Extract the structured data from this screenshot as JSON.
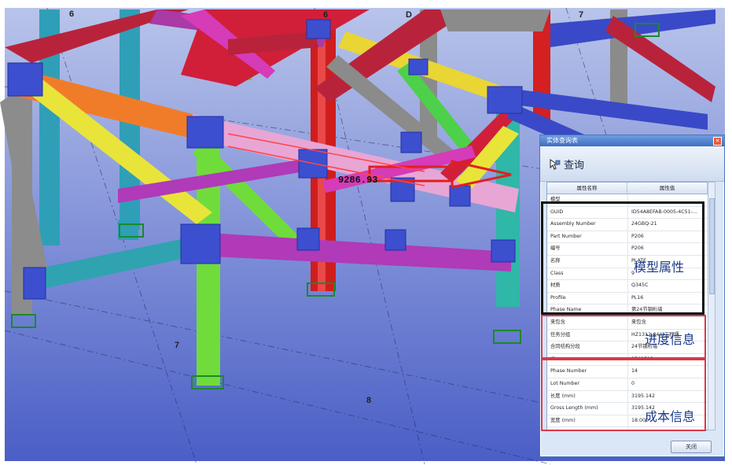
{
  "scene": {
    "grid_labels": [
      "6",
      "6",
      "D",
      "7",
      "7",
      "8"
    ],
    "dimension": "9286.93"
  },
  "dialog": {
    "title": "实体查询表",
    "query_label": "查询",
    "close_label": "关闭",
    "columns": [
      "属性名称",
      "属性值"
    ],
    "rows": [
      {
        "name": "模型",
        "value": ""
      },
      {
        "name": "GUID",
        "value": "ID54A8EFAB-0005-4C51-..."
      },
      {
        "name": "Assembly Number",
        "value": "24GBQ-21"
      },
      {
        "name": "Part Number",
        "value": "P206"
      },
      {
        "name": "编号",
        "value": "P206"
      },
      {
        "name": "名称",
        "value": "PLATE"
      },
      {
        "name": "Class",
        "value": "9"
      },
      {
        "name": "材质",
        "value": "Q345C"
      },
      {
        "name": "Profile",
        "value": "PL16"
      },
      {
        "name": "Phase Name",
        "value": "第24节钢桁墙"
      },
      {
        "name": "来包含",
        "value": "来包含"
      },
      {
        "name": "任务分组",
        "value": "HZ1312-044(工程隔"
      },
      {
        "name": "合同结构分段",
        "value": "24节钢桁墙"
      },
      {
        "name": "ID",
        "value": "9741513"
      },
      {
        "name": "Phase Number",
        "value": "14"
      },
      {
        "name": "Lot Number",
        "value": "0"
      },
      {
        "name": "长度 (mm)",
        "value": "3195.142"
      },
      {
        "name": "Gross Length (mm)",
        "value": "3195.142"
      },
      {
        "name": "宽度 (mm)",
        "value": "18.000"
      },
      {
        "name": "高度 (mm)",
        "value": "300.000"
      }
    ]
  },
  "annotations": {
    "model": "模型属性",
    "progress": "进度信息",
    "cost": "成本信息"
  },
  "colors": {
    "box_model": "#111111",
    "box_info": "#d83a4a",
    "annotation": "#1c3a8a",
    "dialog_title": "#3e6fbf"
  }
}
